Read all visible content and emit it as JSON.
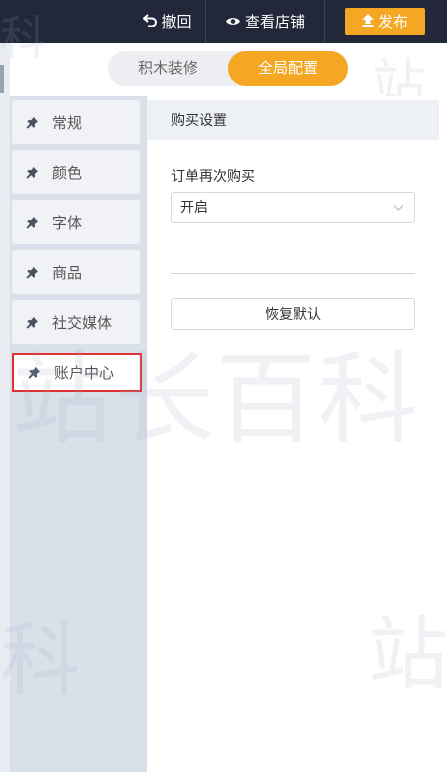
{
  "toolbar": {
    "undo_label": "撤回",
    "view_store_label": "查看店铺",
    "publish_label": "发布"
  },
  "mode_switch": {
    "blocks_label": "积木装修",
    "global_label": "全局配置",
    "selected": "全局配置"
  },
  "sidebar": {
    "items": [
      {
        "label": "常规"
      },
      {
        "label": "颜色"
      },
      {
        "label": "字体"
      },
      {
        "label": "商品"
      },
      {
        "label": "社交媒体"
      },
      {
        "label": "账户中心"
      }
    ],
    "active": "账户中心"
  },
  "panel": {
    "title": "购买设置",
    "reorder_label": "订单再次购买",
    "reorder_value": "开启",
    "reset_label": "恢复默认"
  },
  "watermark": {
    "center": "站长百科",
    "corner_top_left": "科",
    "corner_top_right": "站",
    "corner_bottom_left": "科",
    "corner_bottom_right": "站"
  },
  "colors": {
    "topbar": "#22283a",
    "accent": "#f5a623",
    "nav_bg": "#d9e0e9",
    "highlight": "#e03030"
  }
}
